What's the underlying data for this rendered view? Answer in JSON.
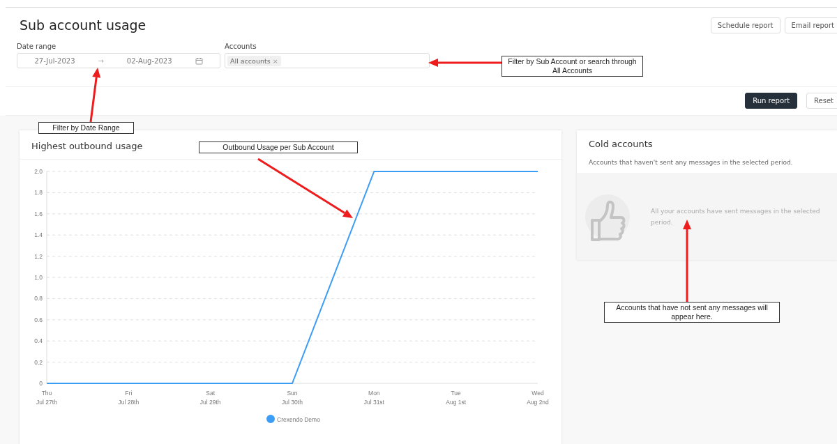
{
  "page": {
    "title": "Sub account usage"
  },
  "header_buttons": [
    "Schedule report",
    "Email report"
  ],
  "filters": {
    "date_range": {
      "label": "Date range",
      "start": "27-Jul-2023",
      "separator": "→",
      "end": "02-Aug-2023"
    },
    "accounts": {
      "label": "Accounts",
      "tags": [
        {
          "label": "All accounts",
          "remove": "×"
        }
      ]
    }
  },
  "actions": [
    {
      "label": "Run report",
      "kind": "primary"
    },
    {
      "label": "Reset",
      "kind": "secondary"
    }
  ],
  "usage_card": {
    "title": "Highest outbound usage",
    "chart_data": {
      "type": "line",
      "categories": [
        "Thu\nJul 27th",
        "Fri\nJul 28th",
        "Sat\nJul 29th",
        "Sun\nJul 30th",
        "Mon\nJul 31st",
        "Tue\nAug 1st",
        "Wed\nAug 2nd"
      ],
      "series": [
        {
          "name": "Crexendo Demo",
          "color": "#3d9df5",
          "values": [
            0,
            0,
            0,
            0,
            2,
            2,
            2
          ]
        }
      ],
      "grid": true,
      "ylim": [
        0,
        2
      ],
      "yticks": [
        {
          "value": 0,
          "label": "0"
        },
        {
          "value": 0.2,
          "label": "0.2"
        },
        {
          "value": 0.4,
          "label": "0.4"
        },
        {
          "value": 0.6,
          "label": "0.6"
        },
        {
          "value": 0.8,
          "label": "0.8"
        },
        {
          "value": 1,
          "label": "1.0"
        },
        {
          "value": 1.2,
          "label": "1.2"
        },
        {
          "value": 1.4,
          "label": "1.4"
        },
        {
          "value": 1.6,
          "label": "1.6"
        },
        {
          "value": 1.8,
          "label": "1.8"
        },
        {
          "value": 2,
          "label": "2.0"
        }
      ]
    }
  },
  "cold_card": {
    "title": "Cold accounts",
    "subtitle": "Accounts that haven't sent any messages in the selected period.",
    "empty_message": "All your accounts have sent messages in the selected period."
  },
  "annotations": [
    {
      "text": "Filter by Date Range"
    },
    {
      "text": "Filter by Sub Account or search through All Accounts"
    },
    {
      "text": "Outbound Usage per Sub Account"
    },
    {
      "text": "Accounts that have not sent any messages will appear here."
    }
  ]
}
